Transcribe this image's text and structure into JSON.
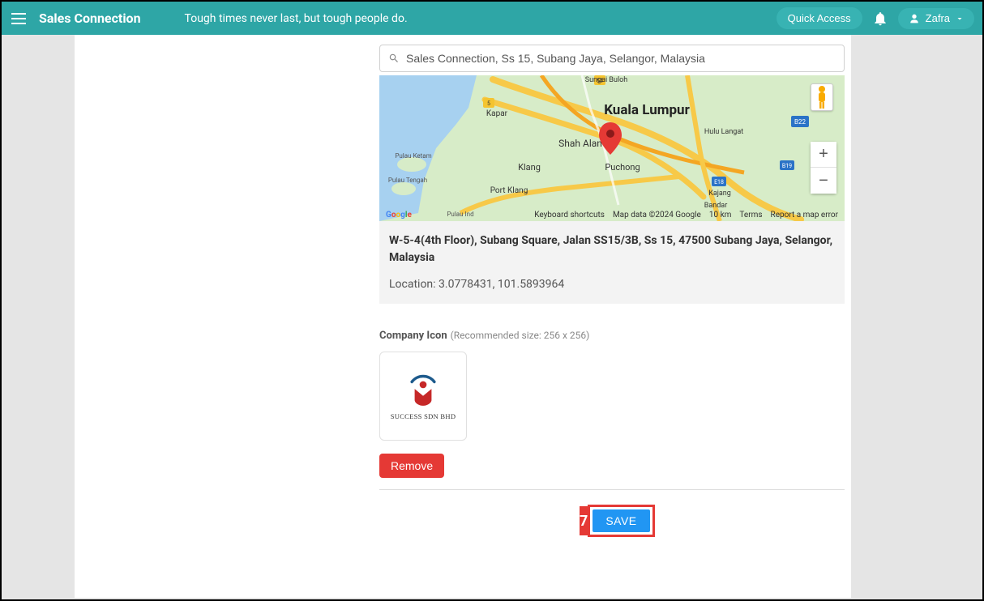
{
  "header": {
    "app_title": "Sales Connection",
    "tagline": "Tough times never last, but tough people do.",
    "quick_access": "Quick Access",
    "user_name": "Zafra"
  },
  "location": {
    "search_value": "Sales Connection, Ss 15, Subang Jaya, Selangor, Malaysia",
    "address": "W-5-4(4th Floor), Subang Square, Jalan SS15/3B, Ss 15, 47500 Subang Jaya, Selangor, Malaysia",
    "coords_label": "Location: 3.0778431, 101.5893964"
  },
  "map": {
    "labels": {
      "kl": "Kuala Lumpur",
      "shah_alam": "Shah Alam",
      "puchong": "Puchong",
      "klang": "Klang",
      "port_klang": "Port Klang",
      "kapar": "Kapar",
      "sungai_buloh": "Sungai Buloh",
      "hulu_langat": "Hulu Langat",
      "kajang": "Kajang",
      "bandar": "Bandar",
      "pulau_ketam": "Pulau Ketam",
      "pulau_tengah": "Pulau Tengah",
      "pulau_ind": "Pulau Ind"
    },
    "footer": {
      "shortcuts": "Keyboard shortcuts",
      "attribution": "Map data ©2024 Google",
      "scale": "10 km",
      "terms": "Terms",
      "report": "Report a map error"
    }
  },
  "company_icon": {
    "label": "Company Icon",
    "hint": "(Recommended size: 256 x 256)",
    "logo_text": "SUCCESS SDN BHD",
    "remove": "Remove"
  },
  "actions": {
    "save": "SAVE"
  },
  "callout": {
    "step": "7"
  }
}
